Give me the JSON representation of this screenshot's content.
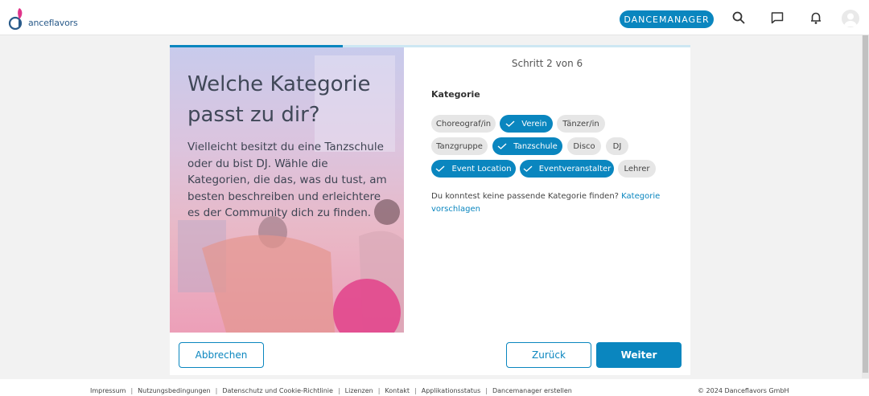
{
  "header": {
    "logo_text": "anceflavors",
    "dancemanager_label": "DANCEMANAGER",
    "icons": [
      "search-icon",
      "chat-icon",
      "bell-icon",
      "user-icon"
    ]
  },
  "progress": {
    "step_fraction": 0.333
  },
  "hero": {
    "title": "Welche Kategorie passt zu dir?",
    "text": "Vielleicht besitzt du eine Tanzschule oder du bist DJ. Wähle die Kategorien, die das, was du tust, am besten beschreiben und erleichtere es der Community dich zu finden."
  },
  "form": {
    "step": "Schritt 2 von 6",
    "category_label": "Kategorie",
    "chips": [
      {
        "label": "Choreograf/in",
        "selected": false
      },
      {
        "label": "Verein",
        "selected": true
      },
      {
        "label": "Tänzer/in",
        "selected": false
      },
      {
        "label": "Tanzgruppe",
        "selected": false
      },
      {
        "label": "Tanzschule",
        "selected": true
      },
      {
        "label": "Disco",
        "selected": false
      },
      {
        "label": "DJ",
        "selected": false
      },
      {
        "label": "Event Location",
        "selected": true
      },
      {
        "label": "Eventveranstalter",
        "selected": true
      },
      {
        "label": "Lehrer",
        "selected": false
      }
    ],
    "hint_text": "Du konntest keine passende Kategorie finden?",
    "hint_link": "Kategorie vorschlagen"
  },
  "buttons": {
    "cancel": "Abbrechen",
    "back": "Zurück",
    "next": "Weiter"
  },
  "footer": {
    "links": [
      "Impressum",
      "Nutzungsbedingungen",
      "Datenschutz und Cookie-Richtlinie",
      "Lizenzen",
      "Kontakt",
      "Applikationsstatus",
      "Dancemanager erstellen"
    ],
    "copyright": "© 2024 Danceflavors GmbH"
  },
  "colors": {
    "accent": "#0a86bf",
    "brand_pink": "#e0348a"
  }
}
